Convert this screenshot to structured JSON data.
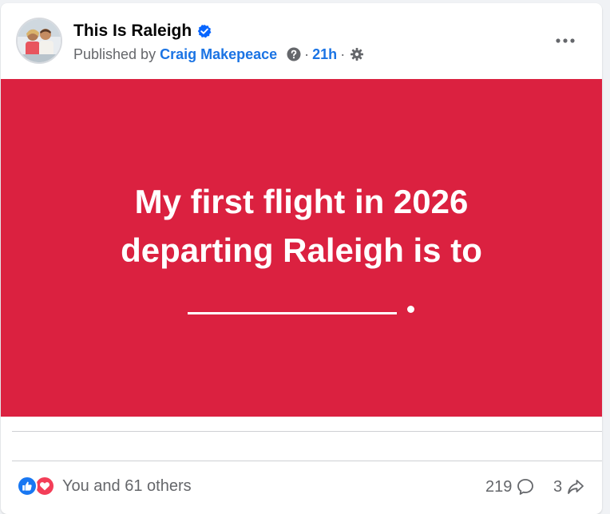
{
  "page": {
    "name": "This Is Raleigh",
    "verified": true
  },
  "meta": {
    "published_by": "Published by",
    "author": "Craig Makepeace",
    "separator": "·",
    "time": "21h"
  },
  "banner": {
    "line1": "My first flight in 2026",
    "line2": "departing Raleigh is to",
    "background": "#db2140"
  },
  "footer": {
    "reactions_text": "You and 61 others",
    "comment_count": "219",
    "share_count": "3"
  },
  "colors": {
    "accent": "#1b74e4",
    "like": "#1877f2",
    "love": "#f33e58"
  },
  "icons": {
    "verified": "verified-badge-icon",
    "help": "question-circle-icon",
    "settings": "gear-icon",
    "more": "more-horizontal-icon",
    "like": "thumbs-up-icon",
    "love": "heart-icon",
    "comment": "comment-bubble-icon",
    "share": "share-arrow-icon"
  }
}
